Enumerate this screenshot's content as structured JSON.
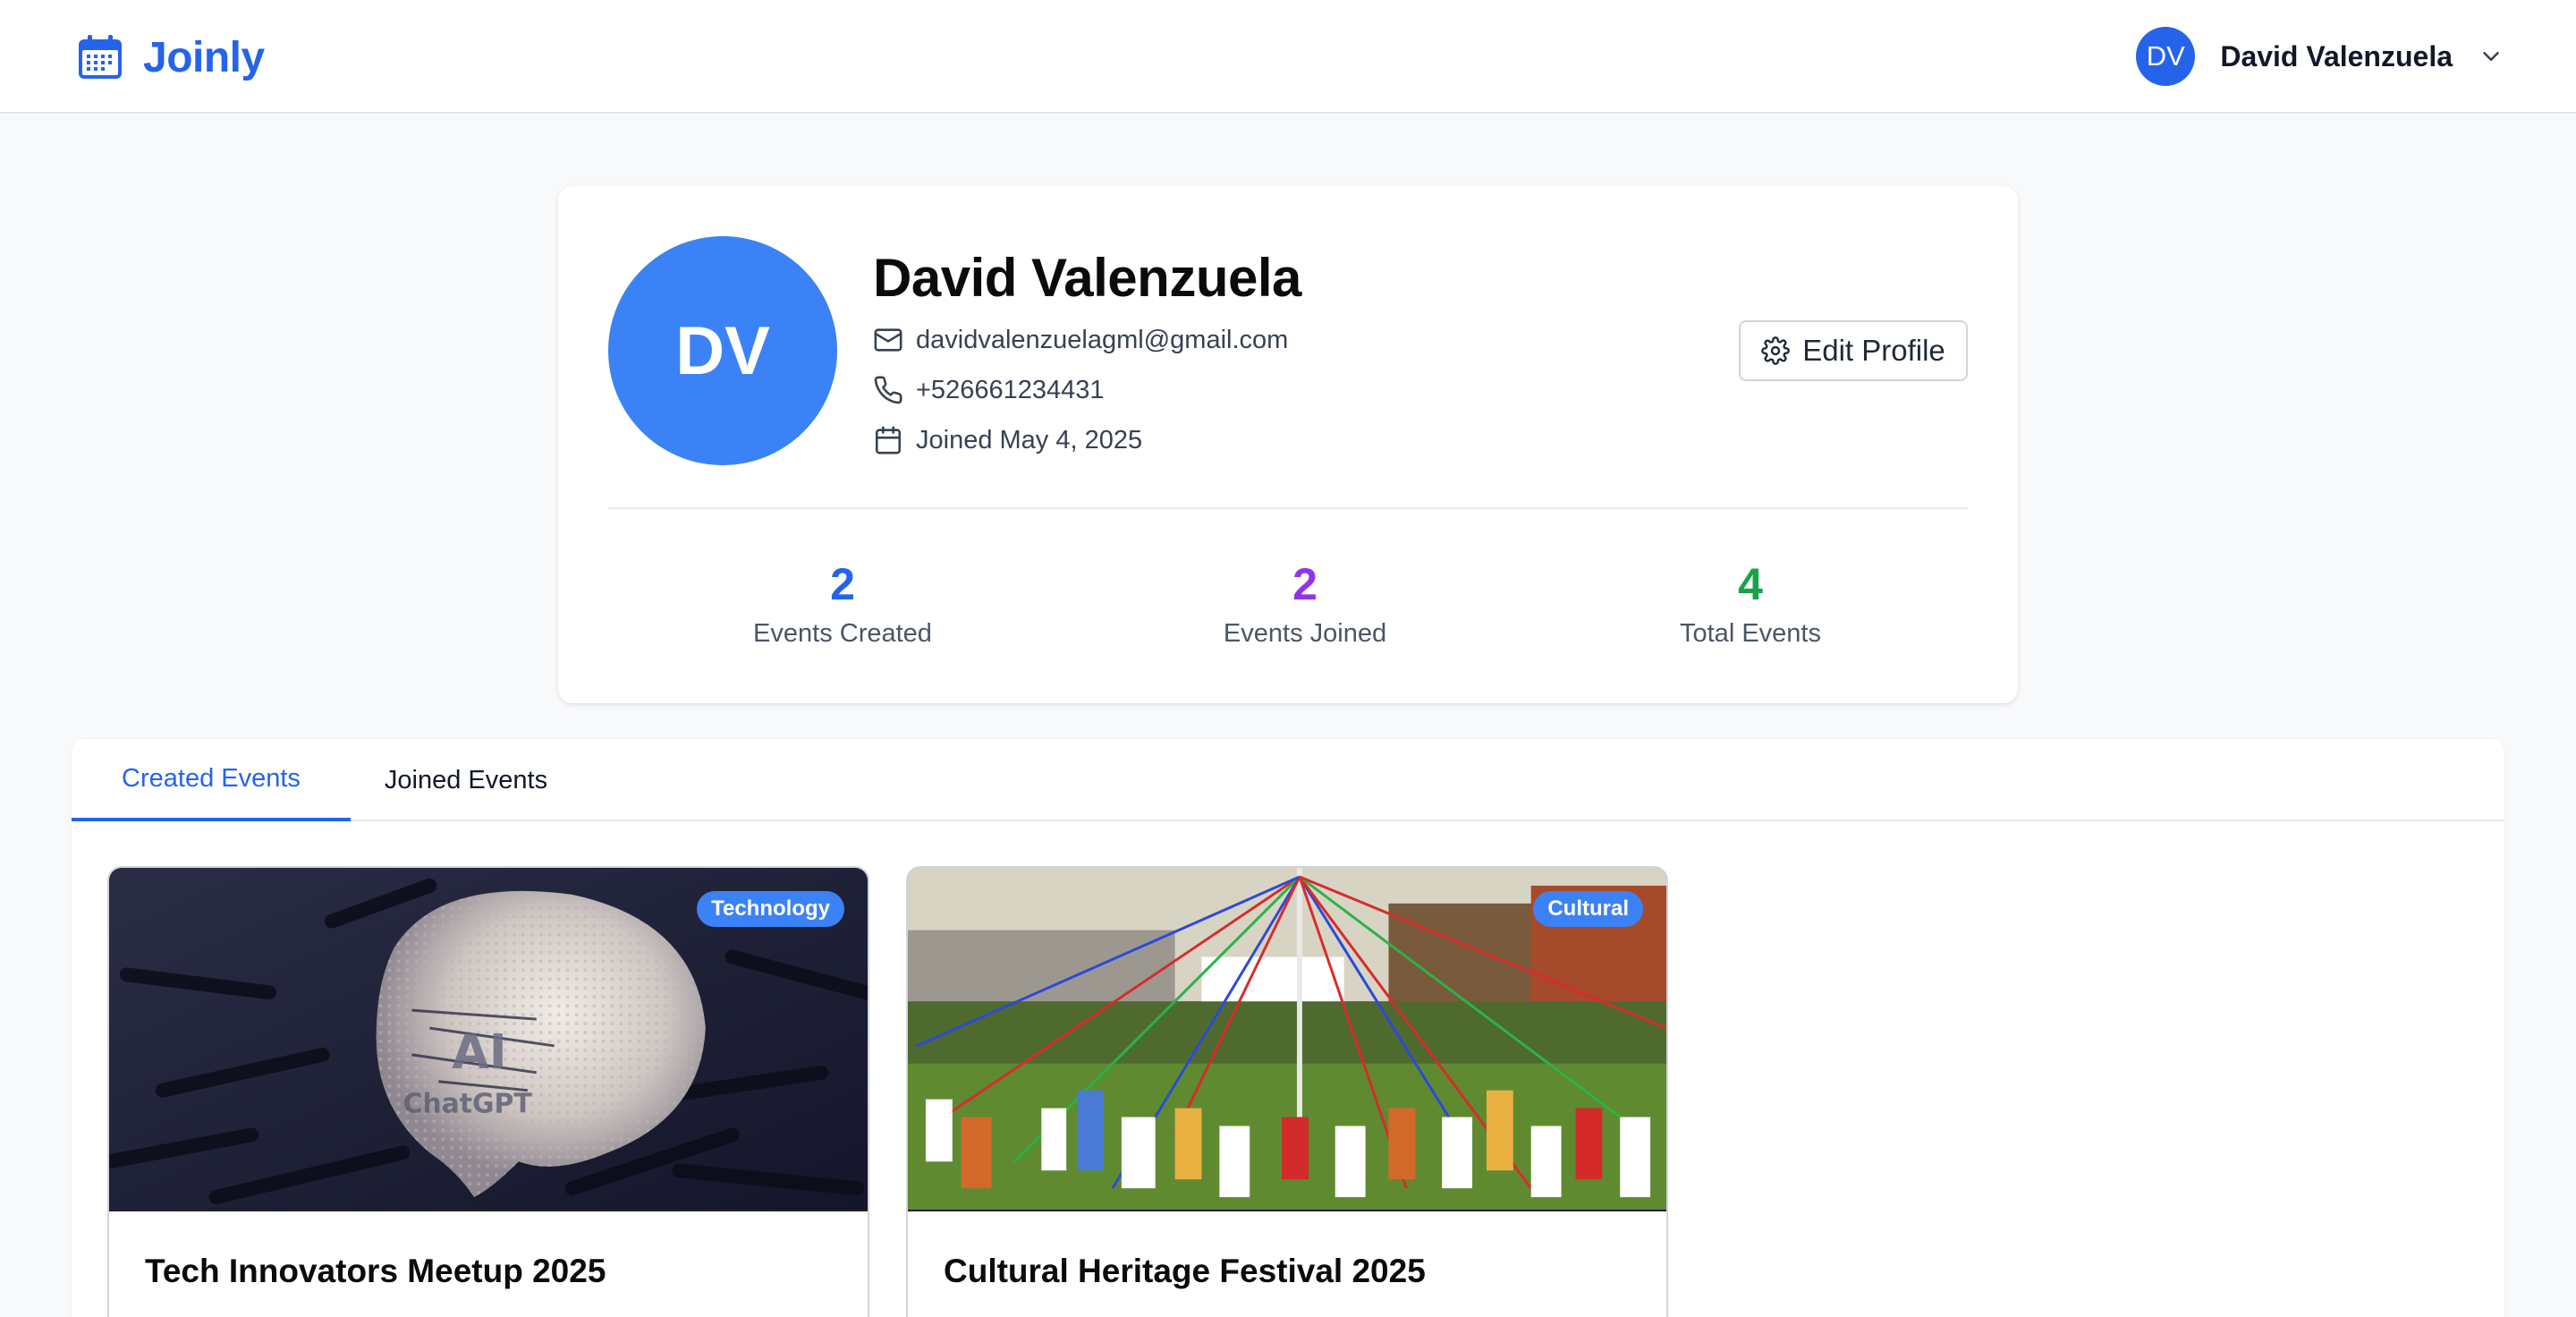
{
  "app": {
    "name": "Joinly",
    "brand_color": "#2563eb"
  },
  "header": {
    "user_initials": "DV",
    "user_name": "David Valenzuela"
  },
  "profile": {
    "initials": "DV",
    "name": "David Valenzuela",
    "email": "davidvalenzuelagml@gmail.com",
    "phone": "+526661234431",
    "joined": "Joined May 4, 2025",
    "edit_button": "Edit Profile"
  },
  "stats": [
    {
      "value": "2",
      "label": "Events Created",
      "color": "#2563eb"
    },
    {
      "value": "2",
      "label": "Events Joined",
      "color": "#9333ea"
    },
    {
      "value": "4",
      "label": "Total Events",
      "color": "#16a34a"
    }
  ],
  "tabs": [
    {
      "label": "Created Events",
      "active": true
    },
    {
      "label": "Joined Events",
      "active": false
    }
  ],
  "events": [
    {
      "title": "Tech Innovators Meetup 2025",
      "category": "Technology",
      "image": "ai-brain-image"
    },
    {
      "title": "Cultural Heritage Festival 2025",
      "category": "Cultural",
      "image": "maypole-festival-image"
    }
  ]
}
